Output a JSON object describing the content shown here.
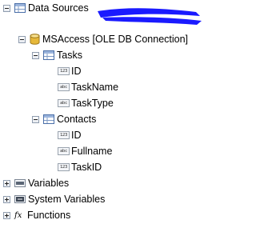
{
  "tree": {
    "data_sources": {
      "label": "Data Sources"
    },
    "connection": {
      "label": "MSAccess [OLE DB Connection]"
    },
    "tables": [
      {
        "label": "Tasks",
        "fields": [
          {
            "type": "123",
            "label": "ID"
          },
          {
            "type": "abc",
            "label": "TaskName"
          },
          {
            "type": "abc",
            "label": "TaskType"
          }
        ]
      },
      {
        "label": "Contacts",
        "fields": [
          {
            "type": "123",
            "label": "ID"
          },
          {
            "type": "abc",
            "label": "Fullname"
          },
          {
            "type": "123",
            "label": "TaskID"
          }
        ]
      }
    ],
    "variables": {
      "label": "Variables"
    },
    "system_variables": {
      "label": "System Variables"
    },
    "functions": {
      "label": "Functions",
      "icon_text": "fx"
    }
  },
  "colors": {
    "redaction": "#1a1aff",
    "toggle_border": "#8f9cae"
  }
}
